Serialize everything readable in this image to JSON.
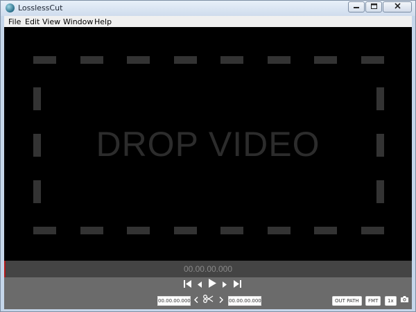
{
  "window": {
    "title": "LosslessCut",
    "buttons": [
      "minimize",
      "maximize",
      "close"
    ]
  },
  "menu": {
    "items": [
      "File",
      "Edit",
      "View",
      "Window",
      "Help"
    ]
  },
  "dropzone": {
    "text": "DROP VIDEO"
  },
  "timeline": {
    "timecode": "00.00.00.000"
  },
  "controls": {
    "cut_start": "00.00.00.000",
    "cut_end": "00.00.00.000",
    "out_path_label": "OUT PATH",
    "format_label": "FMT",
    "speed_label": "1x"
  },
  "colors": {
    "background": "#000000",
    "timeline": "#444444",
    "controls": "#6b6b6b",
    "playhead": "#b11818",
    "dash": "#333333"
  }
}
